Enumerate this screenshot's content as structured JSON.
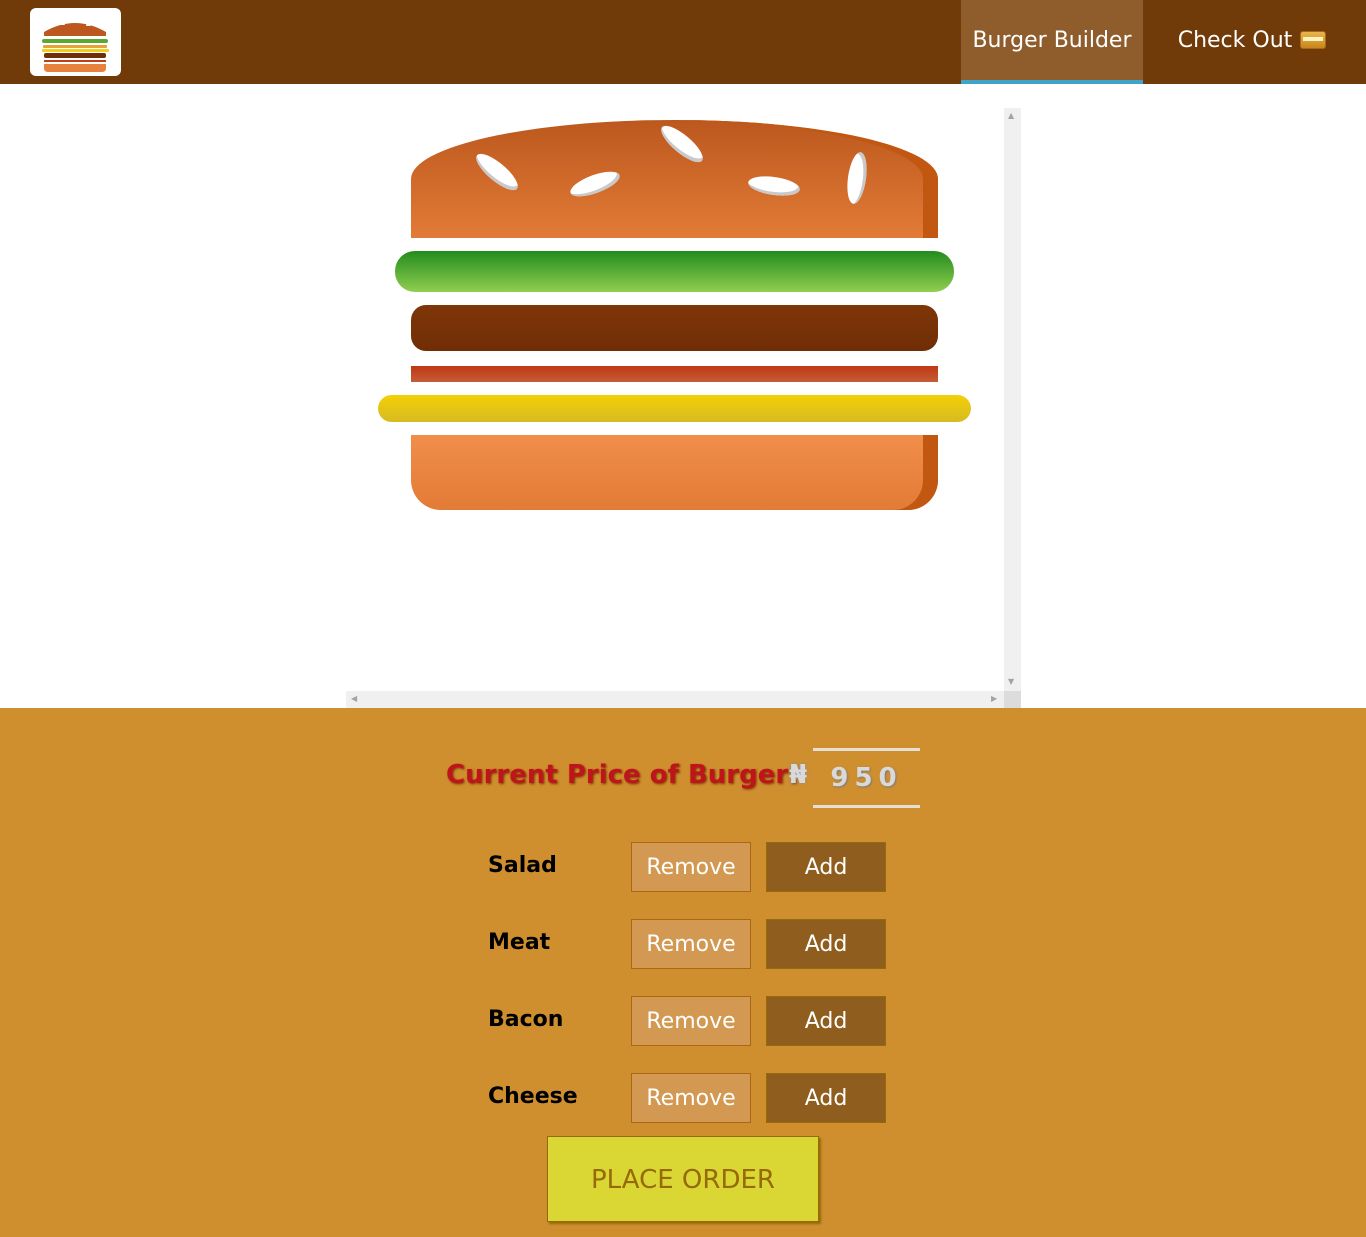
{
  "toolbar": {
    "logo_icon": "burger-logo-icon",
    "nav": [
      {
        "label": "Burger Builder",
        "active": true
      },
      {
        "label": "Check Out",
        "icon": "credit-card-icon",
        "active": false
      }
    ],
    "colors": {
      "background": "#703B09",
      "active_item": "#8F5C2C",
      "active_underline": "#40A4C8"
    }
  },
  "burger": {
    "layers": [
      "bread-top",
      "salad",
      "meat",
      "bacon",
      "cheese",
      "bread-bottom"
    ]
  },
  "controls": {
    "price_label": "Current Price of Burger:",
    "currency_symbol": "₦",
    "price_value": "950",
    "ingredients": [
      {
        "label": "Salad",
        "remove_label": "Remove",
        "add_label": "Add"
      },
      {
        "label": "Meat",
        "remove_label": "Remove",
        "add_label": "Add"
      },
      {
        "label": "Bacon",
        "remove_label": "Remove",
        "add_label": "Add"
      },
      {
        "label": "Cheese",
        "remove_label": "Remove",
        "add_label": "Add"
      }
    ],
    "order_label": "PLACE ORDER",
    "colors": {
      "background": "#CF8F2E",
      "price_label": "#C0141D",
      "remove_button": "#D39952",
      "add_button": "#8F5E1E",
      "order_button": "#DAD735"
    }
  }
}
